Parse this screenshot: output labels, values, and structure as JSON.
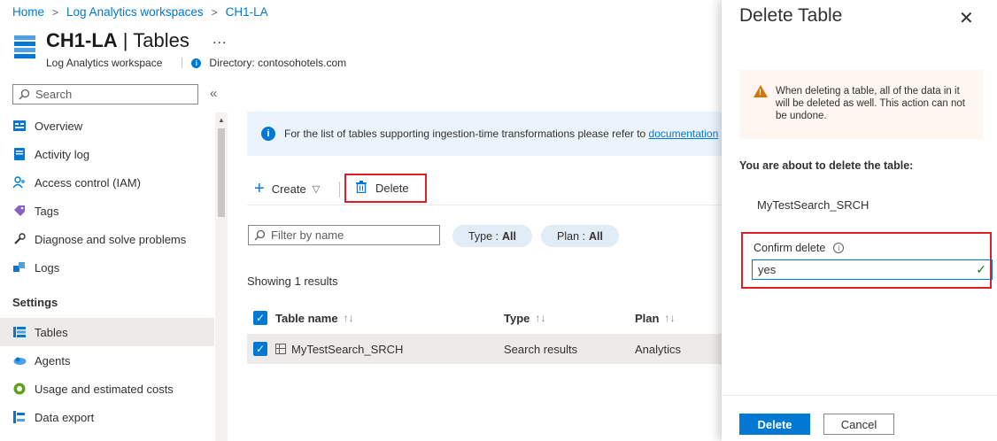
{
  "breadcrumb": {
    "items": [
      "Home",
      "Log Analytics workspaces",
      "CH1-LA"
    ],
    "separator": ">"
  },
  "header": {
    "title_resource": "CH1-LA",
    "title_divider": "|",
    "title_page": "Tables",
    "more": "...",
    "resource_type": "Log Analytics workspace",
    "directory": "Directory: contosohotels.com"
  },
  "sidebar": {
    "search_placeholder": "Search",
    "items": [
      {
        "label": "Overview",
        "icon": "overview-icon"
      },
      {
        "label": "Activity log",
        "icon": "activity-log-icon"
      },
      {
        "label": "Access control (IAM)",
        "icon": "people-icon"
      },
      {
        "label": "Tags",
        "icon": "tag-icon"
      },
      {
        "label": "Diagnose and solve problems",
        "icon": "wrench-icon"
      },
      {
        "label": "Logs",
        "icon": "logs-icon"
      }
    ],
    "section_settings": "Settings",
    "settings_items": [
      {
        "label": "Tables",
        "icon": "table-icon",
        "active": true
      },
      {
        "label": "Agents",
        "icon": "agents-icon"
      },
      {
        "label": "Usage and estimated costs",
        "icon": "usage-icon"
      },
      {
        "label": "Data export",
        "icon": "export-icon"
      }
    ]
  },
  "banner": {
    "text": "For the list of tables supporting ingestion-time transformations please refer to",
    "link": "documentation"
  },
  "toolbar": {
    "create_label": "Create",
    "delete_label": "Delete"
  },
  "filters": {
    "filter_placeholder": "Filter by name",
    "type_label": "Type :",
    "type_value": "All",
    "plan_label": "Plan :",
    "plan_value": "All"
  },
  "results_text": "Showing 1 results",
  "table": {
    "columns": [
      "Table name",
      "Type",
      "Plan"
    ],
    "rows": [
      {
        "name": "MyTestSearch_SRCH",
        "type": "Search results",
        "plan": "Analytics",
        "selected": true
      }
    ]
  },
  "panel": {
    "title": "Delete Table",
    "warning": "When deleting a table, all of the data in it will be deleted as well. This action can not be undone.",
    "about_text": "You are about to delete the table:",
    "table_name": "MyTestSearch_SRCH",
    "confirm_label": "Confirm delete",
    "confirm_value": "yes",
    "delete_button": "Delete",
    "cancel_button": "Cancel"
  },
  "colors": {
    "accent": "#0078d4",
    "highlight_border": "#e01e2a",
    "warning": "#d47500",
    "success": "#107c10"
  }
}
